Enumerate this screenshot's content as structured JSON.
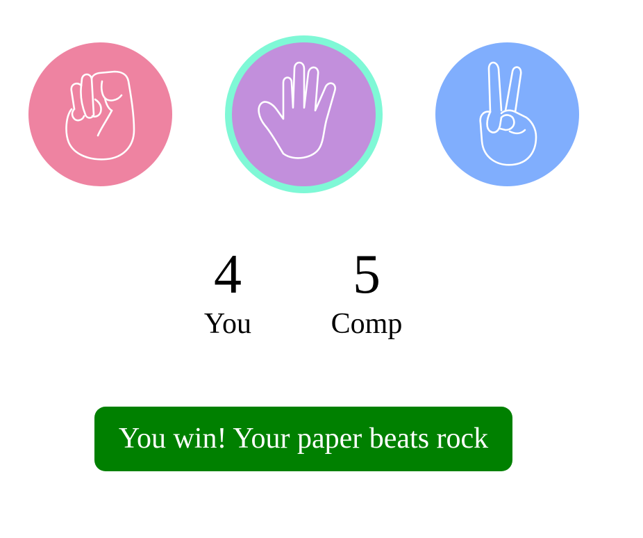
{
  "choices": [
    {
      "id": "rock",
      "icon": "fist-rock-icon",
      "color": "#ee83a1",
      "selected": false
    },
    {
      "id": "paper",
      "icon": "open-hand-paper-icon",
      "color": "#c28fdc",
      "selected": true,
      "ring_color": "#7ff8d6"
    },
    {
      "id": "scissors",
      "icon": "peace-sign-scissors-icon",
      "color": "#80aefd",
      "selected": false
    }
  ],
  "scoreboard": {
    "user_score": "4",
    "user_label": "You",
    "comp_score": "5",
    "comp_label": "Comp"
  },
  "result": {
    "message": "You win! Your paper beats rock",
    "color": "#008000"
  }
}
